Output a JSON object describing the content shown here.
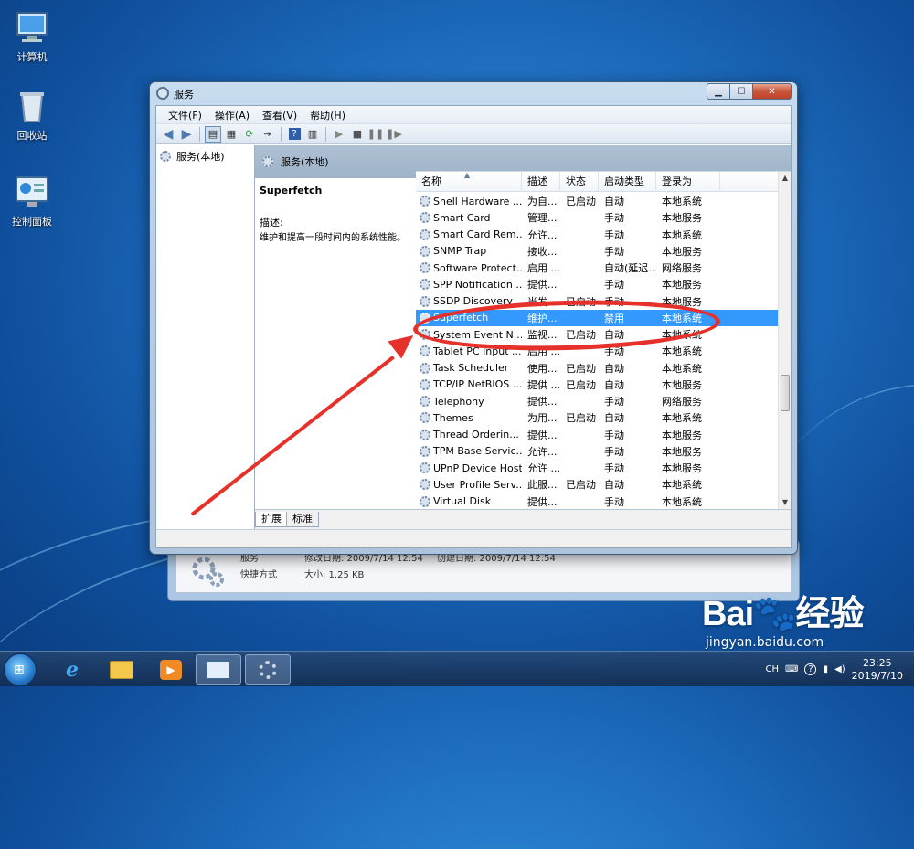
{
  "desktop": {
    "icons": [
      {
        "label": "计算机",
        "icon": "computer-icon"
      },
      {
        "label": "回收站",
        "icon": "recycle-bin-icon"
      },
      {
        "label": "控制面板",
        "icon": "control-panel-icon"
      }
    ]
  },
  "back_window": {
    "row1_name": "服务",
    "row1_modified": "修改日期: 2009/7/14 12:54",
    "row1_created": "创建日期: 2009/7/14 12:54",
    "row2_type": "快捷方式",
    "row2_size": "大小: 1.25 KB"
  },
  "window": {
    "title": "服务",
    "menu": [
      "文件(F)",
      "操作(A)",
      "查看(V)",
      "帮助(H)"
    ],
    "tree_root": "服务(本地)",
    "header_title": "服务(本地)",
    "selected_service": "Superfetch",
    "description_label": "描述:",
    "description_text": "维护和提高一段时间内的系统性能。",
    "columns": {
      "name": "名称",
      "desc": "描述",
      "state": "状态",
      "start": "启动类型",
      "logon": "登录为"
    },
    "services": [
      {
        "name": "Shell Hardware ...",
        "desc": "为自...",
        "state": "已启动",
        "start": "自动",
        "logon": "本地系统"
      },
      {
        "name": "Smart Card",
        "desc": "管理...",
        "state": "",
        "start": "手动",
        "logon": "本地服务"
      },
      {
        "name": "Smart Card Rem...",
        "desc": "允许...",
        "state": "",
        "start": "手动",
        "logon": "本地系统"
      },
      {
        "name": "SNMP Trap",
        "desc": "接收...",
        "state": "",
        "start": "手动",
        "logon": "本地服务"
      },
      {
        "name": "Software Protect...",
        "desc": "启用 ...",
        "state": "",
        "start": "自动(延迟...",
        "logon": "网络服务"
      },
      {
        "name": "SPP Notification ...",
        "desc": "提供...",
        "state": "",
        "start": "手动",
        "logon": "本地服务"
      },
      {
        "name": "SSDP Discovery",
        "desc": "当发...",
        "state": "已启动",
        "start": "手动",
        "logon": "本地服务"
      },
      {
        "name": "Superfetch",
        "desc": "维护...",
        "state": "",
        "start": "禁用",
        "logon": "本地系统"
      },
      {
        "name": "System Event N...",
        "desc": "监视...",
        "state": "已启动",
        "start": "自动",
        "logon": "本地系统"
      },
      {
        "name": "Tablet PC Input ...",
        "desc": "启用 ...",
        "state": "",
        "start": "手动",
        "logon": "本地系统"
      },
      {
        "name": "Task Scheduler",
        "desc": "使用...",
        "state": "已启动",
        "start": "自动",
        "logon": "本地系统"
      },
      {
        "name": "TCP/IP NetBIOS ...",
        "desc": "提供 ...",
        "state": "已启动",
        "start": "自动",
        "logon": "本地服务"
      },
      {
        "name": "Telephony",
        "desc": "提供...",
        "state": "",
        "start": "手动",
        "logon": "网络服务"
      },
      {
        "name": "Themes",
        "desc": "为用...",
        "state": "已启动",
        "start": "自动",
        "logon": "本地系统"
      },
      {
        "name": "Thread Orderin...",
        "desc": "提供...",
        "state": "",
        "start": "手动",
        "logon": "本地服务"
      },
      {
        "name": "TPM Base Servic...",
        "desc": "允许...",
        "state": "",
        "start": "手动",
        "logon": "本地服务"
      },
      {
        "name": "UPnP Device Host",
        "desc": "允许 ...",
        "state": "",
        "start": "手动",
        "logon": "本地服务"
      },
      {
        "name": "User Profile Serv...",
        "desc": "此服...",
        "state": "已启动",
        "start": "自动",
        "logon": "本地系统"
      },
      {
        "name": "Virtual Disk",
        "desc": "提供...",
        "state": "",
        "start": "手动",
        "logon": "本地系统"
      }
    ],
    "tabs": [
      "扩展",
      "标准"
    ]
  },
  "taskbar": {
    "tray_lang": "CH",
    "clock_time": "23:25",
    "clock_date": "2019/7/10"
  },
  "watermark": {
    "logo_text": "Bai",
    "logo_text2": "经验",
    "sub": "jingyan.baidu.com"
  },
  "colors": {
    "selection": "#3399ff",
    "highlight_red": "#e5312a"
  }
}
